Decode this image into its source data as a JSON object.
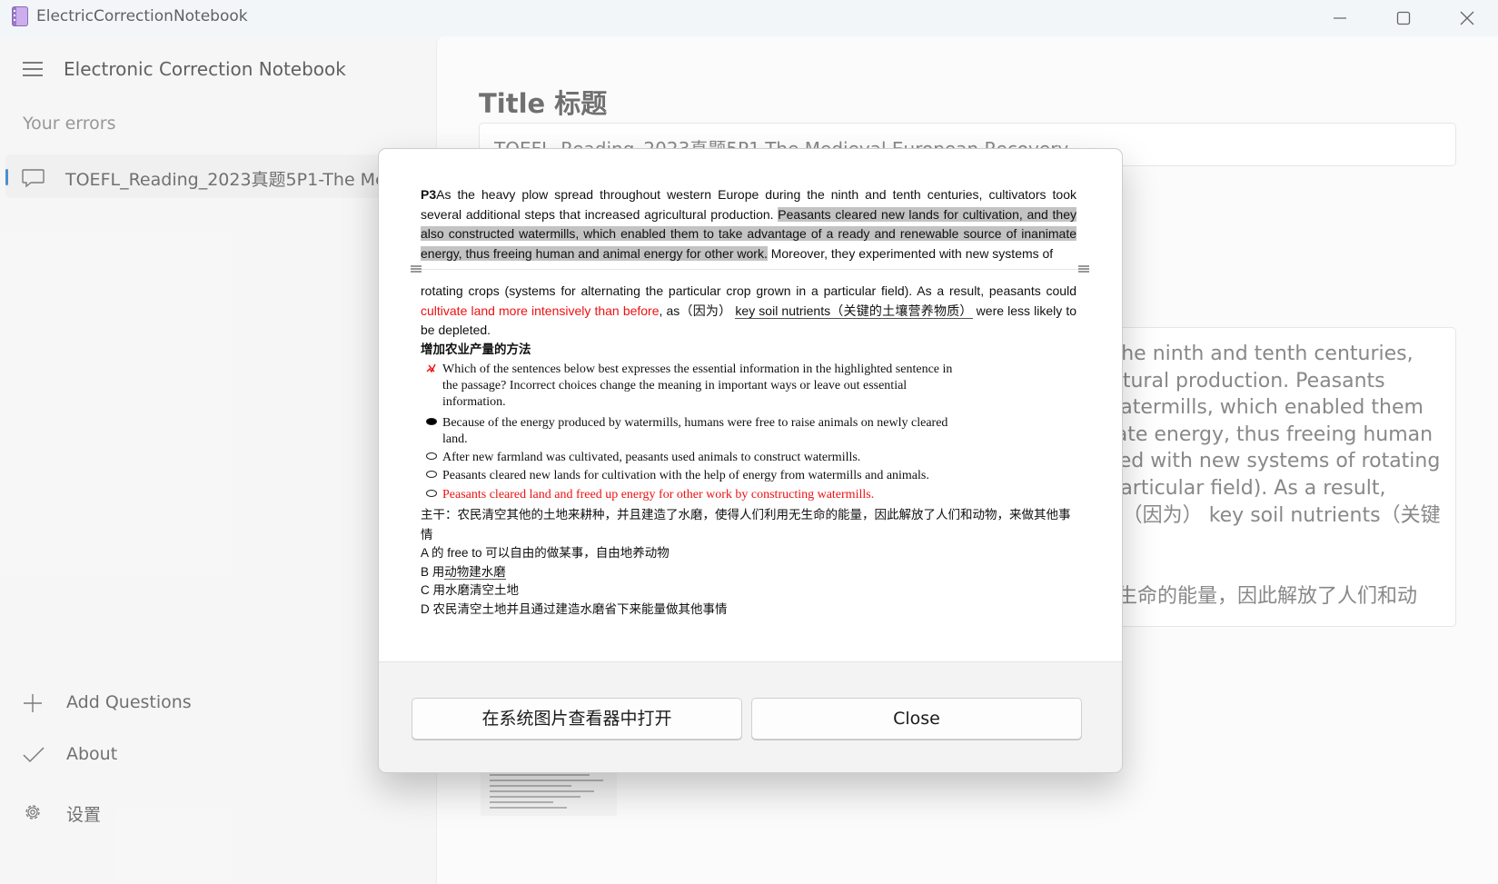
{
  "window": {
    "title": "ElectricCorrectionNotebook"
  },
  "nav": {
    "app_name": "Electronic Correction Notebook",
    "section_label": "Your errors",
    "selected_item": "TOEFL_Reading_2023真题5P1-The Medieval European Recovery",
    "add_questions": "Add Questions",
    "about": "About",
    "settings": "设置"
  },
  "main": {
    "title_label": "Title 标题",
    "title_value": "TOEFL_Reading_2023真题5P1-The Medieval European Recovery",
    "content_lines": [
      "As the heavy plow spread throughout western Europe during the ninth and tenth centuries, cultivators",
      "took several additional steps that increased agricultural production. Peasants cleared new lands for",
      "cultivation, and they also constructed watermills, which enabled them to take advantage of a ready and",
      "renewable source of inanimate energy, thus freeing human and animal energy for other work. Moreover,",
      "they experimented with new systems of rotating crops (systems for alternating the particular crop grown",
      "in a particular field). As a result, peasants could cultivate land more intensively than before, as（因为）",
      "key soil nutrients（关键的土壤营养物质）were less likely to be depleted."
    ],
    "content_cn": "主干：农民清空其他的土地来耕种，并且建造了水磨，使得人们利用无生命的能量，因此解放了人们和动物，来做其他事情"
  },
  "dialog": {
    "p3_label": "P3",
    "p3_intro": "As the heavy plow spread throughout western Europe during the ninth and tenth centuries, cultivators took several additional steps that increased agricultural production. ",
    "p3_highlight": "Peasants cleared new lands for cultivation, and they also constructed watermills, which enabled them to take advantage of a ready and renewable source of inanimate energy, thus freeing human and animal energy for other work.",
    "p3_after": " Moreover, they experimented with new systems of",
    "p3b_start": "rotating crops (systems for alternating the particular crop grown in a particular field). As a result, peasants could ",
    "p3b_red": "cultivate land more intensively than before",
    "p3b_mid": ", as（因为） ",
    "p3b_underline": "key soil nutrients（关键的土壤营养物质）",
    "p3b_end": " were less likely to be depleted.",
    "section_heading": "增加农业产量的方法",
    "question": "Which of the sentences below best expresses the essential information in the highlighted sentence in the passage? Incorrect choices change the meaning in important ways or leave out essential information.",
    "options": [
      "Because of the energy produced by watermills, humans were free to raise animals on newly cleared land.",
      "After new farmland was cultivated, peasants used animals to construct watermills.",
      "Peasants cleared new lands for cultivation with the help of energy from watermills and animals.",
      "Peasants cleared land and freed up energy for other work by constructing watermills."
    ],
    "analysis_main": "主干：农民清空其他的土地来耕种，并且建造了水磨，使得人们利用无生命的能量，因此解放了人们和动物，来做其他事情",
    "analysis_a": "A 的 free to 可以自由的做某事，自由地养动物",
    "analysis_b_prefix": "B 用",
    "analysis_b_underline": "动物建水磨",
    "analysis_c": "C 用水磨清空土地",
    "analysis_d": "D 农民清空土地并且通过建造水磨省下来能量做其他事情",
    "open_button": "在系统图片查看器中打开",
    "close_button": "Close"
  },
  "colors": {
    "accent": "#005fb8",
    "error_red": "#e11111",
    "highlight": "#c3c3c3"
  }
}
